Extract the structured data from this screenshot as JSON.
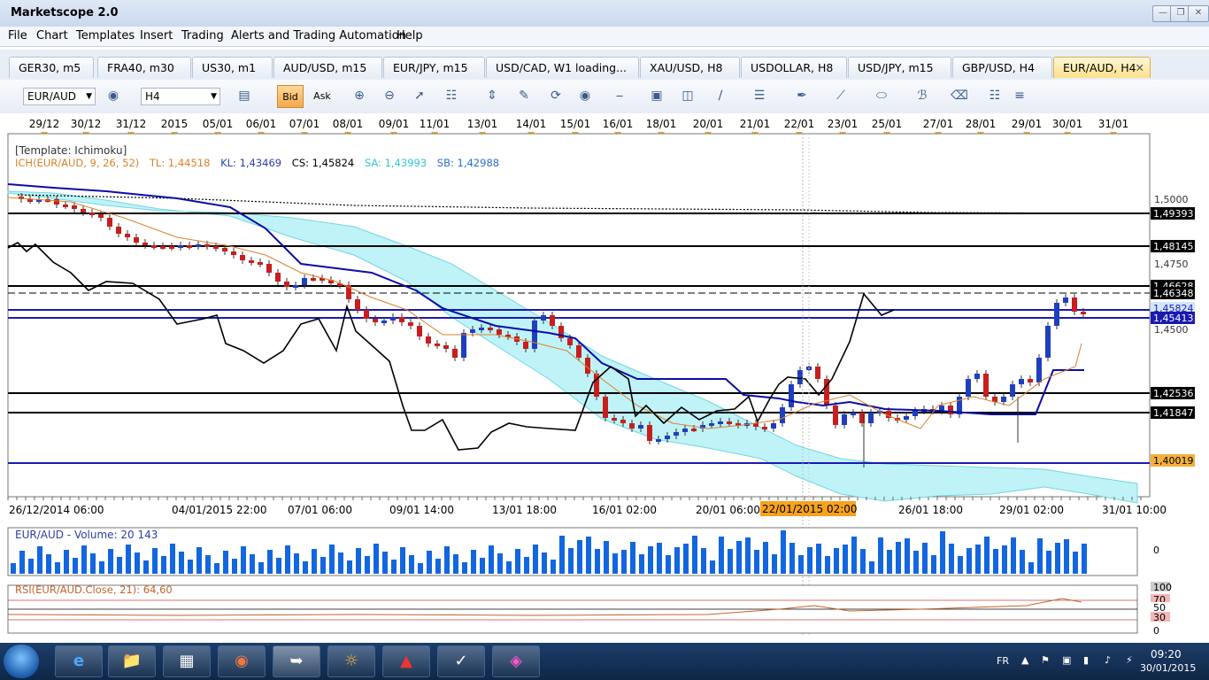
{
  "window": {
    "title": "Marketscope 2.0"
  },
  "menu": [
    "File",
    "Chart",
    "Templates",
    "Insert",
    "Trading",
    "Alerts and Trading Automation",
    "Help"
  ],
  "tabs": [
    "GER30, m5",
    "FRA40, m30",
    "US30, m1",
    "AUD/USD, m15",
    "EUR/JPY, m15",
    "USD/CAD, W1 loading...",
    "XAU/USD, H8",
    "USDOLLAR, H8",
    "USD/JPY, m15",
    "GBP/USD, H4",
    "EUR/AUD, H4"
  ],
  "toolbar": {
    "symbol": "EUR/AUD",
    "timeframe": "H4",
    "bid_label": "Bid",
    "ask_label": "Ask"
  },
  "chart": {
    "template_label": "[Template: Ichimoku]",
    "ichimoku": {
      "name": "ICH(EUR/AUD, 9, 26, 52)",
      "tl": "TL: 1,44518",
      "kl": "KL: 1,43469",
      "cs": "CS: 1,45824",
      "sa": "SA: 1,43993",
      "sb": "SB: 1,42988"
    },
    "top_dates": [
      "29/12",
      "30/12",
      "31/12",
      "2015",
      "05/01",
      "06/01",
      "07/01",
      "08/01",
      "09/01",
      "11/01",
      "13/01",
      "14/01",
      "15/01",
      "16/01",
      "18/01",
      "20/01",
      "21/01",
      "22/01",
      "23/01",
      "25/01",
      "27/01",
      "28/01",
      "29/01",
      "30/01",
      "31/01"
    ],
    "bottom_dates": [
      "26/12/2014 06:00",
      "04/01/2015 22:00",
      "07/01 06:00",
      "09/01 14:00",
      "13/01 18:00",
      "16/01 02:00",
      "20/01 06:00",
      "26/01 18:00",
      "29/01 02:00",
      "31/01 10:00"
    ],
    "crosshair_date": "22/01/2015 02:00",
    "price_axis": [
      "1,5000",
      "1,4750",
      "1,4500"
    ],
    "level_labels": [
      "1,49393",
      "1,48145",
      "1,46628",
      "1,46348",
      "1,45824",
      "1,45413",
      "1,42536",
      "1,41847",
      "1,40019"
    ],
    "volume_label": "EUR/AUD - Volume: 20 143",
    "volume_axis": "0",
    "rsi_label": "RSI(EUR/AUD.Close, 21): 64,60",
    "rsi_axis": [
      "100",
      "70",
      "50",
      "30",
      "0"
    ]
  },
  "taskbar": {
    "lang": "FR",
    "time": "09:20",
    "date": "30/01/2015"
  },
  "colors": {
    "bull": "#1f3fbf",
    "bear": "#c81e1e",
    "cloud": "#bff3f7",
    "kijun": "#0c0ca8",
    "rsi": "#c0652a"
  }
}
